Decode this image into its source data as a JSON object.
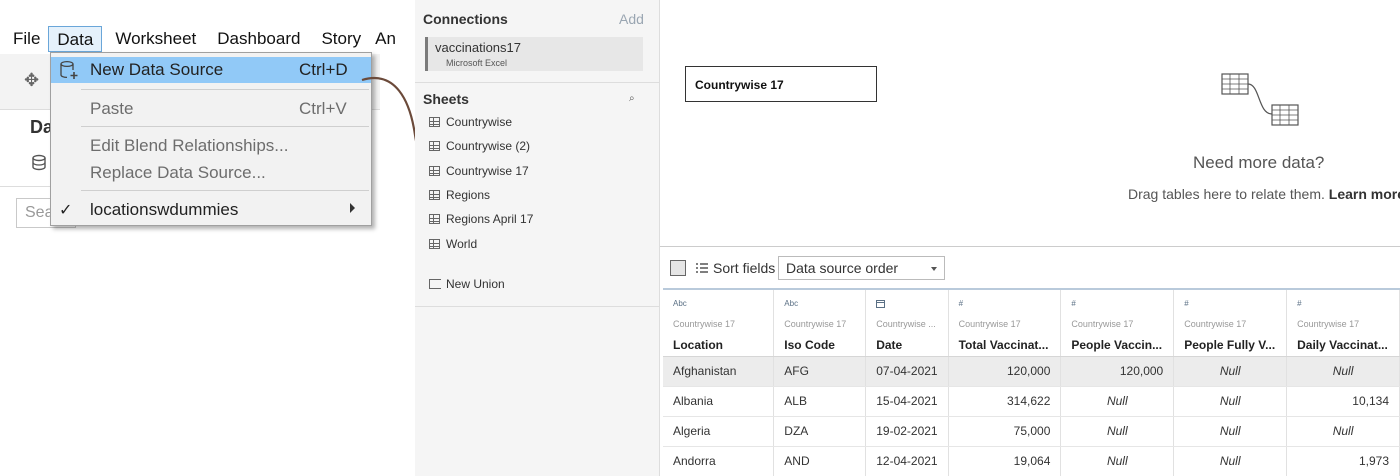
{
  "menubar": [
    "File",
    "Data",
    "Worksheet",
    "Dashboard",
    "Story",
    "An"
  ],
  "data_menu": {
    "items": [
      {
        "label": "New Data Source",
        "shortcut": "Ctrl+D",
        "icon": "database-add-icon",
        "highlighted": true
      },
      {
        "label": "Paste",
        "shortcut": "Ctrl+V",
        "disabled": true
      },
      {
        "label": "Edit Blend Relationships...",
        "shortcut": "",
        "disabled": true
      },
      {
        "label": "Replace Data Source...",
        "shortcut": "",
        "disabled": true
      },
      {
        "label": "locationswdummies",
        "shortcut": "",
        "checked": true,
        "submenu": true
      }
    ]
  },
  "left_pane": {
    "title": "Da",
    "search_placeholder": "Sea"
  },
  "connections": {
    "title": "Connections",
    "add_label": "Add",
    "items": [
      {
        "name": "vaccinations17",
        "type": "Microsoft Excel"
      }
    ]
  },
  "sheets": {
    "title": "Sheets",
    "items": [
      "Countrywise",
      "Countrywise (2)",
      "Countrywise 17",
      "Regions",
      "Regions April 17",
      "World"
    ],
    "new_union_label": "New Union"
  },
  "canvas": {
    "table_name": "Countrywise 17",
    "need_more_title": "Need more data?",
    "need_more_text": "Drag tables here to relate them. ",
    "learn_more": "Learn more"
  },
  "grid": {
    "sort_label": "Sort fields",
    "sort_value": "Data source order",
    "columns": [
      {
        "type": "Abc",
        "source": "Countrywise 17",
        "name": "Location"
      },
      {
        "type": "Abc",
        "source": "Countrywise 17",
        "name": "Iso Code"
      },
      {
        "type": "calendar-icon",
        "source": "Countrywise ...",
        "name": "Date"
      },
      {
        "type": "#",
        "source": "Countrywise 17",
        "name": "Total Vaccinat..."
      },
      {
        "type": "#",
        "source": "Countrywise 17",
        "name": "People Vaccin..."
      },
      {
        "type": "#",
        "source": "Countrywise 17",
        "name": "People Fully V..."
      },
      {
        "type": "#",
        "source": "Countrywise 17",
        "name": "Daily Vaccinat..."
      }
    ],
    "rows": [
      [
        "Afghanistan",
        "AFG",
        "07-04-2021",
        "120,000",
        "120,000",
        "Null",
        "Null"
      ],
      [
        "Albania",
        "ALB",
        "15-04-2021",
        "314,622",
        "Null",
        "Null",
        "10,134"
      ],
      [
        "Algeria",
        "DZA",
        "19-02-2021",
        "75,000",
        "Null",
        "Null",
        "Null"
      ],
      [
        "Andorra",
        "AND",
        "12-04-2021",
        "19,064",
        "Null",
        "Null",
        "1,973"
      ]
    ]
  }
}
